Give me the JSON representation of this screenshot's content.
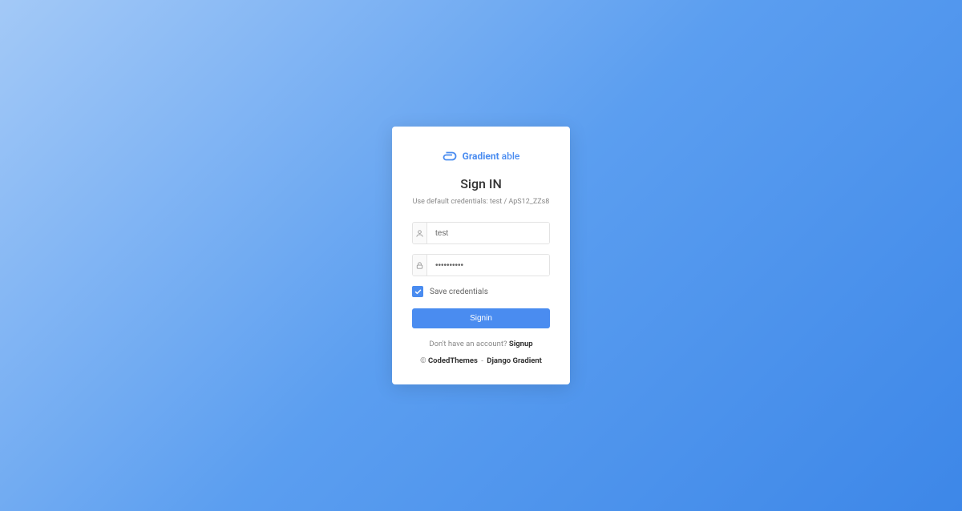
{
  "logo": {
    "brand_primary": "Gradient",
    "brand_secondary": "able"
  },
  "title": "Sign IN",
  "subtitle": "Use default credentials: test / ApS12_ZZs8",
  "form": {
    "username_value": "test",
    "password_value": "••••••••••",
    "save_credentials_label": "Save credentials",
    "save_credentials_checked": true,
    "signin_button": "Signin"
  },
  "signup": {
    "prompt": "Don't have an account? ",
    "link": "Signup"
  },
  "footer": {
    "copyright": "© ",
    "link1": "CodedThemes",
    "separator": " - ",
    "link2": "Django Gradient"
  },
  "colors": {
    "primary": "#4a8cf0"
  }
}
